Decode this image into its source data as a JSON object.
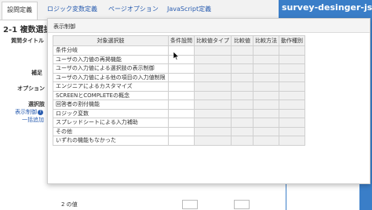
{
  "tabs": [
    {
      "label": "設問定義"
    },
    {
      "label": "ロジック変数定義"
    },
    {
      "label": "ページオプション"
    },
    {
      "label": "JavaScript定義"
    }
  ],
  "brand": "survey-desinger-js",
  "section_title": "2-1 複数選択",
  "left_labels": {
    "question_title": "質問タイトル",
    "supplement": "補足",
    "options": "オプション",
    "choices": "選択肢",
    "display_control": "表示制御",
    "bulk_add": "一括追加"
  },
  "bottom_value": "2 の値",
  "modal": {
    "title": "表示制御",
    "columns": [
      "対象選択肢",
      "条件設問",
      "比較値タイプ",
      "比較値",
      "比較方法",
      "動作種別"
    ],
    "rows": [
      "条件分岐",
      "ユーザの入力値の再掲機能",
      "ユーザの入力値による選択肢の表示制御",
      "ユーザの入力値による他の項目の入力値制限",
      "エンジニアによるカスタマイズ",
      "SCREENとCOMPLETEの概念",
      "回答者の割付機能",
      "ロジック変数",
      "スプレッドシートによる入力補助",
      "その他",
      "いずれの機能もなかった"
    ]
  },
  "colors": {
    "brand_blue": "#3a7ec8",
    "link_blue": "#2a5db0",
    "grid_shade": "#f0f0f0"
  }
}
